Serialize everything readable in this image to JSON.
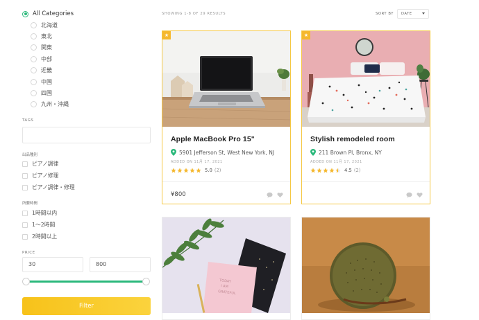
{
  "sidebar": {
    "all_categories": "All Categories",
    "regions": [
      "北海道",
      "東北",
      "関東",
      "中部",
      "近畿",
      "中国",
      "四国",
      "九州・沖縄"
    ],
    "tags_label": "TAGS",
    "tags_value": "",
    "service_label": "出品種別",
    "services": [
      "ピアノ調律",
      "ピアノ修理",
      "ピアノ調律・修理"
    ],
    "duration_label": "所要時間",
    "durations": [
      "1時間以内",
      "1〜2時間",
      "2時間以上"
    ],
    "price_label": "PRICE",
    "price_min": "30",
    "price_max": "800",
    "filter_label": "Filter"
  },
  "header": {
    "results_text": "SHOWING 1-8 OF 29 RESULTS",
    "sort_label": "SORT BY",
    "sort_value": "DATE"
  },
  "colors": {
    "accent_green": "#2ab87b",
    "accent_yellow": "#f7c21a",
    "star": "#f5b82e"
  },
  "listings": [
    {
      "title": "Apple MacBook Pro 15\"",
      "address": "5901 Jefferson St, West New York, NJ",
      "added": "ADDED ON 11月 17, 2021",
      "rating": "5.0",
      "rating_count": "(2)",
      "stars": 5,
      "price": "¥800",
      "featured": true,
      "image": "macbook-on-desk"
    },
    {
      "title": "Stylish remodeled room",
      "address": "211 Brown Pl, Bronx, NY",
      "added": "ADDED ON 11月 17, 2021",
      "rating": "4.5",
      "rating_count": "(2)",
      "stars": 4.5,
      "price": "",
      "featured": true,
      "image": "bedroom"
    },
    {
      "image": "pink-notebook-leaves",
      "featured": false
    },
    {
      "image": "round-speaker",
      "featured": false
    }
  ],
  "icons": [
    "pin-icon",
    "star-icon",
    "comment-icon",
    "heart-icon",
    "featured-star-icon",
    "chevron-down-icon"
  ]
}
